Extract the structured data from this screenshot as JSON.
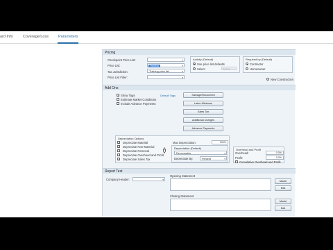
{
  "tabs": [
    {
      "label": "ard Info"
    },
    {
      "label": "Coverage/Loss"
    },
    {
      "label": "Parameters"
    }
  ],
  "pricing": {
    "header": "Pricing",
    "checkpoint_label": "Checkpoint Price List:",
    "price_list_label": "Price List:",
    "price_list_value": "Training",
    "tax_label": "Tax Jurisdiction:",
    "tax_value": "Training price list",
    "price_filter_label": "Price List Filter:",
    "activity": {
      "title": "Activity (Default)",
      "opt1": "Use price list defaults",
      "opt2": "Select",
      "opt2_greyed": "Replace"
    },
    "required_by": {
      "title": "Required by (Default)",
      "opt1": "Contractor",
      "opt2": "Homeowner"
    },
    "new_construction": "New Construction"
  },
  "add_ons": {
    "header": "Add Ons",
    "show_tags": "Show Tags",
    "default_tags": "Default Tags",
    "estimate_market": "Estimate Market Conditions",
    "include_advance": "Include Advance Payments",
    "buttons": [
      "Salvage/Recovered",
      "Labor Minimum",
      "Sales Tax",
      "Additional Charges",
      "Advance Payments"
    ]
  },
  "depreciation": {
    "title": "Depreciation Options",
    "items": [
      {
        "label": "Depreciate Material",
        "checked": true
      },
      {
        "label": "Depreciate Non-Material",
        "checked": true
      },
      {
        "label": "Depreciate Removal",
        "checked": false
      },
      {
        "label": "Depreciate Overhead and Profit",
        "checked": true
      },
      {
        "label": "Depreciate Sales Tax",
        "checked": true
      }
    ],
    "max_dep_label": "Max Depreciation:",
    "max_dep_value": "100%",
    "dep_default_title": "Depreciation (Default)",
    "dep_type_value": "Recoverable",
    "dep_by_label": "Depreciate By:",
    "dep_by_value": "Percent"
  },
  "overhead": {
    "title": "Overhead and Profit",
    "overhead_label": "Overhead:",
    "overhead_value": "0.0%",
    "profit_label": "Profit:",
    "profit_value": "0.0%",
    "cumulative": "Cumulative Overhead and Profit"
  },
  "report_text": {
    "header": "Report Text",
    "company_header_label": "Company Header:",
    "opening_label": "Opening Statement",
    "closing_label": "Closing Statement",
    "model_btn": "Model",
    "edit_btn": "Edit"
  }
}
